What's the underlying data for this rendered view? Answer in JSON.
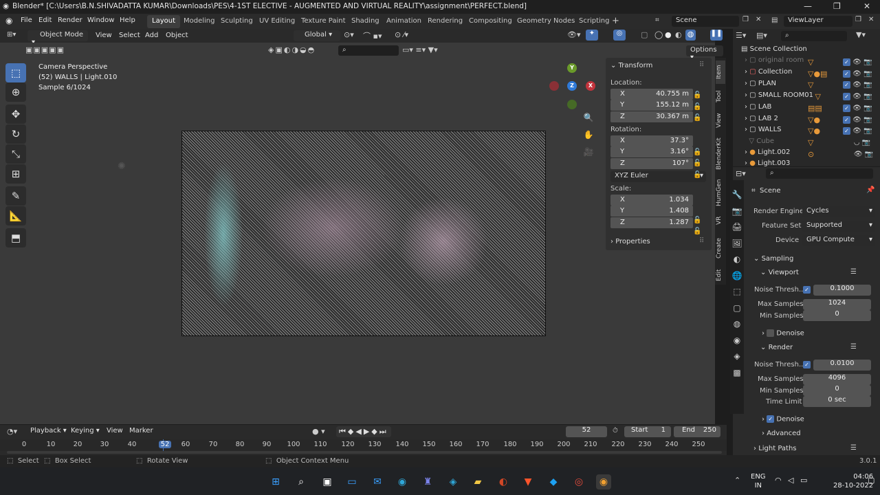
{
  "window": {
    "title": "Blender* [C:\\Users\\B.N.SHIVADATTA KUMAR\\Downloads\\PES\\4-1ST ELECTIVE - AUGMENTED AND VIRTUAL REALITY\\assignment\\PERFECT.blend]"
  },
  "menu": [
    "File",
    "Edit",
    "Render",
    "Window",
    "Help"
  ],
  "workspaces": [
    "Layout",
    "Modeling",
    "Sculpting",
    "UV Editing",
    "Texture Paint",
    "Shading",
    "Animation",
    "Rendering",
    "Compositing",
    "Geometry Nodes",
    "Scripting"
  ],
  "scene": "Scene",
  "view_layer": "ViewLayer",
  "header3d": {
    "mode": "Object Mode",
    "view": "View",
    "select": "Select",
    "add": "Add",
    "object": "Object",
    "orientation": "Global",
    "options": "Options"
  },
  "overlay": {
    "line1": "Camera Perspective",
    "line2": "(52) WALLS | Light.010",
    "line3": "Sample 6/1024"
  },
  "gizmo": {
    "x": "X",
    "y": "Y",
    "z": "Z"
  },
  "transform": {
    "title": "Transform",
    "location_label": "Location:",
    "loc": [
      "40.755 m",
      "155.12 m",
      "30.367 m"
    ],
    "rotation_label": "Rotation:",
    "rot": [
      "37.3°",
      "3.16°",
      "107°"
    ],
    "euler": "XYZ Euler",
    "scale_label": "Scale:",
    "scale": [
      "1.034",
      "1.408",
      "1.287"
    ],
    "axes": [
      "X",
      "Y",
      "Z"
    ],
    "properties": "Properties"
  },
  "vtabs": [
    "Item",
    "Tool",
    "View",
    "BlenderKit",
    "HumGen",
    "VR",
    "Create",
    "Edit"
  ],
  "outliner": {
    "title": "Scene Collection",
    "rows": [
      "original room",
      "Collection",
      "PLAN",
      "SMALL ROOM01",
      "LAB",
      "LAB 2",
      "WALLS",
      "Cube",
      "Light.002",
      "Light.003"
    ]
  },
  "props": {
    "scene": "Scene",
    "render_engine_label": "Render Engine",
    "render_engine": "Cycles",
    "feature_set_label": "Feature Set",
    "feature_set": "Supported",
    "device_label": "Device",
    "device": "GPU Compute",
    "sampling": "Sampling",
    "viewport": "Viewport",
    "noise_label": "Noise Thresh...",
    "vp_noise": "0.1000",
    "max_label": "Max Samples",
    "vp_max": "1024",
    "min_label": "Min Samples",
    "vp_min": "0",
    "denoise": "Denoise",
    "render": "Render",
    "r_noise": "0.0100",
    "r_max": "4096",
    "r_min": "0",
    "time_label": "Time Limit",
    "r_time": "0 sec",
    "advanced": "Advanced",
    "light_paths": "Light Paths"
  },
  "timeline": {
    "playback": "Playback",
    "keying": "Keying",
    "view": "View",
    "marker": "Marker",
    "frame": "52",
    "start_label": "Start",
    "start": "1",
    "end_label": "End",
    "end": "250",
    "ticks": [
      "0",
      "10",
      "20",
      "30",
      "40",
      "52",
      "60",
      "70",
      "80",
      "90",
      "100",
      "110",
      "120",
      "130",
      "140",
      "150",
      "160",
      "170",
      "180",
      "190",
      "200",
      "210",
      "220",
      "230",
      "240",
      "250"
    ]
  },
  "status": {
    "select": "Select",
    "box_select": "Box Select",
    "rotate": "Rotate View",
    "context": "Object Context Menu",
    "version": "3.0.1"
  },
  "taskbar": {
    "lang1": "ENG",
    "lang2": "IN",
    "time": "04:06",
    "date": "28-10-2022"
  }
}
